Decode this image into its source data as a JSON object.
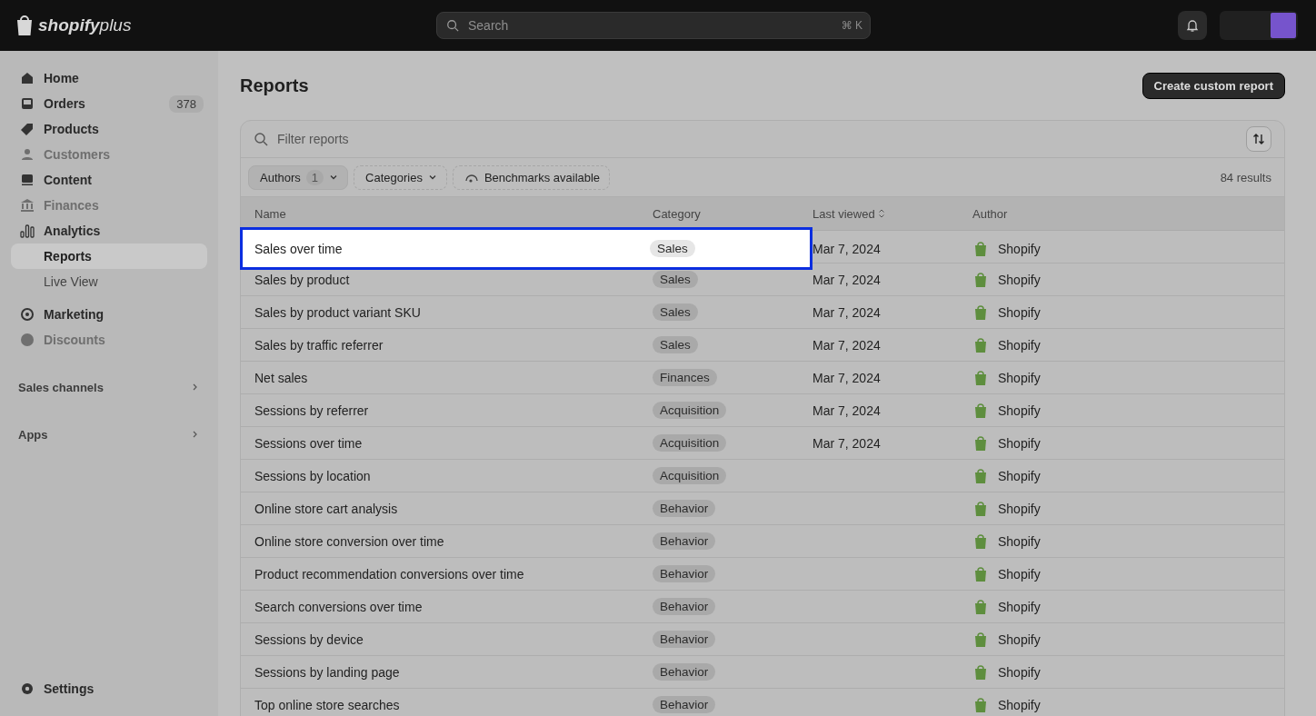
{
  "topbar": {
    "logo_word": "shopify",
    "logo_suffix": "plus",
    "search": {
      "placeholder": "Search",
      "shortcut": "⌘ K"
    }
  },
  "sidebar": {
    "items": [
      {
        "label": "Home",
        "disabled": false,
        "selected": false
      },
      {
        "label": "Orders",
        "disabled": false,
        "selected": false,
        "count": "378"
      },
      {
        "label": "Products",
        "disabled": false,
        "selected": false
      },
      {
        "label": "Customers",
        "disabled": true,
        "selected": false
      },
      {
        "label": "Content",
        "disabled": false,
        "selected": false
      },
      {
        "label": "Finances",
        "disabled": true,
        "selected": false
      },
      {
        "label": "Analytics",
        "disabled": false,
        "selected": false,
        "children": [
          {
            "label": "Reports",
            "selected": true
          },
          {
            "label": "Live View",
            "selected": false
          }
        ]
      },
      {
        "label": "Marketing",
        "disabled": false,
        "selected": false
      },
      {
        "label": "Discounts",
        "disabled": true,
        "selected": false
      }
    ],
    "sections": [
      "Sales channels",
      "Apps"
    ],
    "settings": "Settings"
  },
  "page": {
    "title": "Reports",
    "primary_action": "Create custom report",
    "filter": {
      "placeholder": "Filter reports"
    },
    "chips": [
      {
        "label": "Authors",
        "count": "1",
        "kind": "dropdown",
        "active": true
      },
      {
        "label": "Categories",
        "kind": "dropdown",
        "active": false
      },
      {
        "label": "Benchmarks available",
        "kind": "toggle",
        "active": false
      }
    ],
    "results": "84 results",
    "table": {
      "columns": [
        "Name",
        "Category",
        "Last viewed",
        "Author"
      ],
      "rows": [
        {
          "name": "Sales over time",
          "category": "Sales",
          "last_viewed": "Mar 7, 2024",
          "author": "Shopify",
          "highlighted": true
        },
        {
          "name": "Sales by product",
          "category": "Sales",
          "last_viewed": "Mar 7, 2024",
          "author": "Shopify",
          "highlighted": false
        },
        {
          "name": "Sales by product variant SKU",
          "category": "Sales",
          "last_viewed": "Mar 7, 2024",
          "author": "Shopify",
          "highlighted": false
        },
        {
          "name": "Sales by traffic referrer",
          "category": "Sales",
          "last_viewed": "Mar 7, 2024",
          "author": "Shopify",
          "highlighted": false
        },
        {
          "name": "Net sales",
          "category": "Finances",
          "last_viewed": "Mar 7, 2024",
          "author": "Shopify",
          "highlighted": false
        },
        {
          "name": "Sessions by referrer",
          "category": "Acquisition",
          "last_viewed": "Mar 7, 2024",
          "author": "Shopify",
          "highlighted": false
        },
        {
          "name": "Sessions over time",
          "category": "Acquisition",
          "last_viewed": "Mar 7, 2024",
          "author": "Shopify",
          "highlighted": false
        },
        {
          "name": "Sessions by location",
          "category": "Acquisition",
          "author": "Shopify",
          "highlighted": false
        },
        {
          "name": "Online store cart analysis",
          "category": "Behavior",
          "author": "Shopify",
          "highlighted": false
        },
        {
          "name": "Online store conversion over time",
          "category": "Behavior",
          "author": "Shopify",
          "highlighted": false
        },
        {
          "name": "Product recommendation conversions over time",
          "category": "Behavior",
          "author": "Shopify",
          "highlighted": false
        },
        {
          "name": "Search conversions over time",
          "category": "Behavior",
          "author": "Shopify",
          "highlighted": false
        },
        {
          "name": "Sessions by device",
          "category": "Behavior",
          "author": "Shopify",
          "highlighted": false
        },
        {
          "name": "Sessions by landing page",
          "category": "Behavior",
          "author": "Shopify",
          "highlighted": false
        },
        {
          "name": "Top online store searches",
          "category": "Behavior",
          "author": "Shopify",
          "highlighted": false
        }
      ]
    }
  }
}
